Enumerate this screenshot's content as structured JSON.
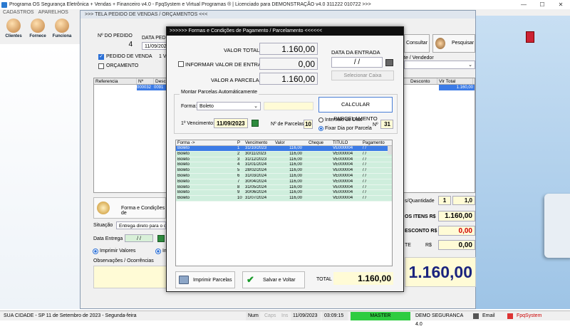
{
  "app": {
    "title": "Programa OS Segurança Eletrônica + Vendas + Financeiro v4.0 - FpqSystem e Virtual Programas ® | Licenciado para  DEMONSTRAÇÃO v4.0 311222 010722 >>>",
    "menu": [
      "CADASTROS",
      "APARELHOS"
    ],
    "toolbar": [
      "Clientes",
      "Fornece",
      "Funciona"
    ]
  },
  "main": {
    "header": ">>>  TELA PEDIDO DE VENDAS / ORÇAMENTOS   <<<",
    "nr_pedido_label": "Nº DO PEDIDO",
    "nr_pedido": "4",
    "data_pedido_label": "DATA PEDIDO",
    "data_pedido": "11/09/2023",
    "pedido_venda_label": "PEDIDO DE VENDA",
    "orcamento_label": "ORÇAMENTO",
    "v_label": "1 V",
    "consultar": "Consultar",
    "pesquisar": "Pesquisar",
    "vendedor_label": "te / Vendedor",
    "grid_cols": [
      "Referencia",
      "Nº",
      "Descr",
      "Desconto",
      "Vlr Total"
    ],
    "grid_row": {
      "ref": "",
      "nr": "000032",
      "desc": "0091",
      "total": "1.160,00"
    },
    "forma_btn": "Forma e Condições de",
    "situacao_label": "Situação",
    "situacao_value": "Entrega direto para o clie",
    "data_entrega_label": "Data Entrega",
    "data_entrega_value": "/ /",
    "imprimir_valores": "Imprimir Valores",
    "im_label": "Im",
    "observacoes_label": "Observações / Ocorrências",
    "qtd_label": "s/Quantidade",
    "qtd_a": "1",
    "qtd_b": "1,0",
    "itens_label": "OS ITENS R$",
    "itens_value": "1.160,00",
    "desconto_label": "ESCONTO R$",
    "desconto_value": "0,00",
    "te_label": "TE",
    "rs_label": "R$",
    "te_value": "0,00",
    "big_total": "1.160,00"
  },
  "modal": {
    "title": ">>>>>> Formas e Condições de Pagamento / Parcelamento  <<<<<<",
    "valor_total_label": "VALOR TOTAL",
    "valor_total": "1.160,00",
    "informar_label": "INFORMAR VALOR DE ENTRADA",
    "valor_entrada": "0,00",
    "valor_parcelar_label": "VALOR A PARCELAR",
    "valor_parcelar": "1.160,00",
    "data_entrada_label": "DATA DA ENTRADA",
    "data_entrada": "/ /",
    "selecionar_caixa": "Selecionar Caixa",
    "montar_label": "Montar Parcelas Automáticamente",
    "forma_label": "Forma:",
    "forma_value": "Boleto",
    "calcular": "CALCULAR PARCELAMENTO",
    "venc_label": "1º Vencimento:",
    "venc_value": "11/09/2023",
    "nparc_label": "Nº de Parcelas",
    "nparc_value": "10",
    "intervalo_label": "Intervalo de Dias",
    "fixar_label": "Fixar Dia por Parcela",
    "dia_label": "Nº",
    "dia_value": "31",
    "table_cols": [
      "Forma ->",
      "P",
      "Vencimento",
      "Valor",
      "Cheque",
      "TITULO",
      "Pagamento"
    ],
    "rows": [
      {
        "forma": "Boleto",
        "p": "1",
        "venc": "31/10/2023",
        "valor": "116,00",
        "cheque": "",
        "titulo": "VE000004",
        "pag": "/ /"
      },
      {
        "forma": "Boleto",
        "p": "2",
        "venc": "30/11/2023",
        "valor": "116,00",
        "cheque": "",
        "titulo": "VE000004",
        "pag": "/ /"
      },
      {
        "forma": "Boleto",
        "p": "3",
        "venc": "31/12/2023",
        "valor": "116,00",
        "cheque": "",
        "titulo": "VE000004",
        "pag": "/ /"
      },
      {
        "forma": "Boleto",
        "p": "4",
        "venc": "31/01/2024",
        "valor": "116,00",
        "cheque": "",
        "titulo": "VE000004",
        "pag": "/ /"
      },
      {
        "forma": "Boleto",
        "p": "5",
        "venc": "28/02/2024",
        "valor": "116,00",
        "cheque": "",
        "titulo": "VE000004",
        "pag": "/ /"
      },
      {
        "forma": "Boleto",
        "p": "6",
        "venc": "31/03/2024",
        "valor": "116,00",
        "cheque": "",
        "titulo": "VE000004",
        "pag": "/ /"
      },
      {
        "forma": "Boleto",
        "p": "7",
        "venc": "30/04/2024",
        "valor": "116,00",
        "cheque": "",
        "titulo": "VE000004",
        "pag": "/ /"
      },
      {
        "forma": "Boleto",
        "p": "8",
        "venc": "31/05/2024",
        "valor": "116,00",
        "cheque": "",
        "titulo": "VE000004",
        "pag": "/ /"
      },
      {
        "forma": "Boleto",
        "p": "9",
        "venc": "30/06/2024",
        "valor": "116,00",
        "cheque": "",
        "titulo": "VE000004",
        "pag": "/ /"
      },
      {
        "forma": "Boleto",
        "p": "10",
        "venc": "31/07/2024",
        "valor": "116,00",
        "cheque": "",
        "titulo": "VE000004",
        "pag": "/ /"
      }
    ],
    "imprimir": "Imprimir Parcelas",
    "salvar": "Salvar e Voltar",
    "total_label": "TOTAL",
    "total_value": "1.160,00"
  },
  "status": {
    "cidade": "SUA CIDADE - SP 11 de Setembro de 2023 - Segunda-feira",
    "num": "Num",
    "caps": "Caps",
    "ins": "Ins",
    "date": "11/09/2023",
    "time": "03:09:15",
    "master": "MASTER",
    "demo": "DEMO SEGURANCA 4.0",
    "email": "Email",
    "fpq": "FpqSystem"
  },
  "colors": {
    "accent": "#3c7be6",
    "row_green": "#cfeedd",
    "field_yellow": "#fffbd6",
    "red_value": "#d00000"
  }
}
